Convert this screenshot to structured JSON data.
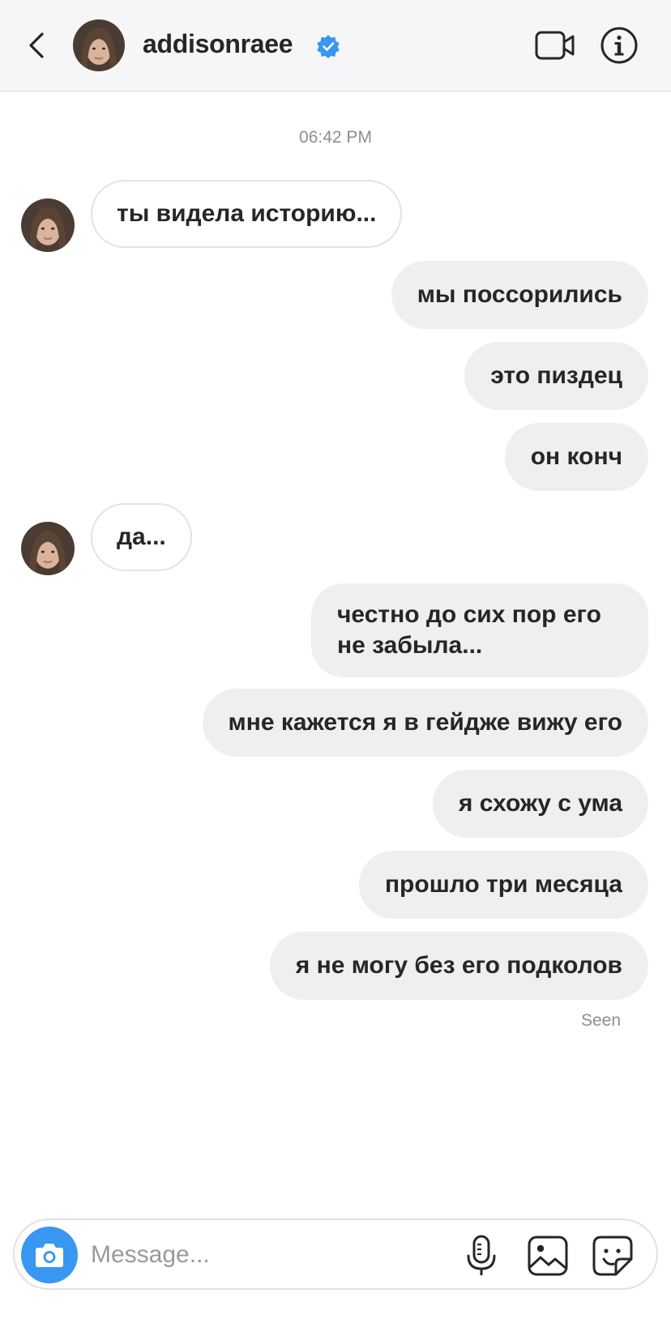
{
  "header": {
    "username": "addisonraee",
    "verified": true,
    "icons": [
      "back-icon",
      "verified-badge-icon",
      "video-call-icon",
      "info-icon"
    ]
  },
  "conversation": {
    "timestamp": "06:42 PM",
    "messages": [
      {
        "sender": "them",
        "text": "ты видела историю..."
      },
      {
        "sender": "me",
        "text": "мы поссорились"
      },
      {
        "sender": "me",
        "text": "это пиздец"
      },
      {
        "sender": "me",
        "text": "он конч"
      },
      {
        "sender": "them",
        "text": "да..."
      },
      {
        "sender": "me",
        "text": "честно до сих пор его не забыла..."
      },
      {
        "sender": "me",
        "text": "мне кажется я в гейдже вижу его"
      },
      {
        "sender": "me",
        "text": "я схожу с ума"
      },
      {
        "sender": "me",
        "text": "прошло три месяца"
      },
      {
        "sender": "me",
        "text": "я не могу без его подколов"
      }
    ],
    "seen_label": "Seen"
  },
  "composer": {
    "placeholder": "Message...",
    "icons": [
      "camera-icon",
      "microphone-icon",
      "gallery-icon",
      "sticker-icon"
    ]
  },
  "colors": {
    "header_bg": "#f6f6f8",
    "outgoing_bubble": "#efeff1",
    "incoming_border": "#e3e3e6",
    "verified_blue": "#3897f0",
    "camera_blue": "#3897f0"
  }
}
